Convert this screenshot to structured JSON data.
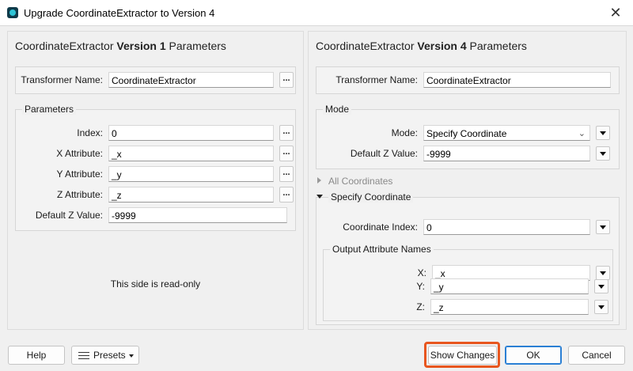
{
  "window": {
    "title": "Upgrade CoordinateExtractor to Version 4",
    "close_glyph": "✕"
  },
  "left": {
    "title_prefix": "CoordinateExtractor ",
    "title_bold": "Version 1",
    "title_suffix": " Parameters",
    "transformer_name_label": "Transformer Name:",
    "transformer_name_value": "CoordinateExtractor",
    "parameters_group": "Parameters",
    "index_label": "Index:",
    "index_value": "0",
    "x_attr_label": "X Attribute:",
    "x_attr_value": "_x",
    "y_attr_label": "Y Attribute:",
    "y_attr_value": "_y",
    "z_attr_label": "Z Attribute:",
    "z_attr_value": "_z",
    "default_z_label": "Default Z Value:",
    "default_z_value": "-9999",
    "readonly_note": "This side is read-only",
    "dots": "..."
  },
  "right": {
    "title_prefix": "CoordinateExtractor ",
    "title_bold": "Version 4",
    "title_suffix": " Parameters",
    "transformer_name_label": "Transformer Name:",
    "transformer_name_value": "CoordinateExtractor",
    "mode_group": "Mode",
    "mode_label": "Mode:",
    "mode_value": "Specify Coordinate",
    "default_z_label": "Default Z Value:",
    "default_z_value": "-9999",
    "all_coordinates": "All Coordinates",
    "specify_coordinate": "Specify Coordinate",
    "coord_index_label": "Coordinate Index:",
    "coord_index_value": "0",
    "output_group": "Output Attribute Names",
    "x_label": "X:",
    "x_value": "_x",
    "y_label": "Y:",
    "y_value": "_y",
    "z_label": "Z:",
    "z_value": "_z"
  },
  "footer": {
    "help": "Help",
    "presets": "Presets",
    "show_changes": "Show Changes",
    "ok": "OK",
    "cancel": "Cancel"
  },
  "colors": {
    "highlight": "#e8561f",
    "ok_border": "#2a7fd4"
  }
}
